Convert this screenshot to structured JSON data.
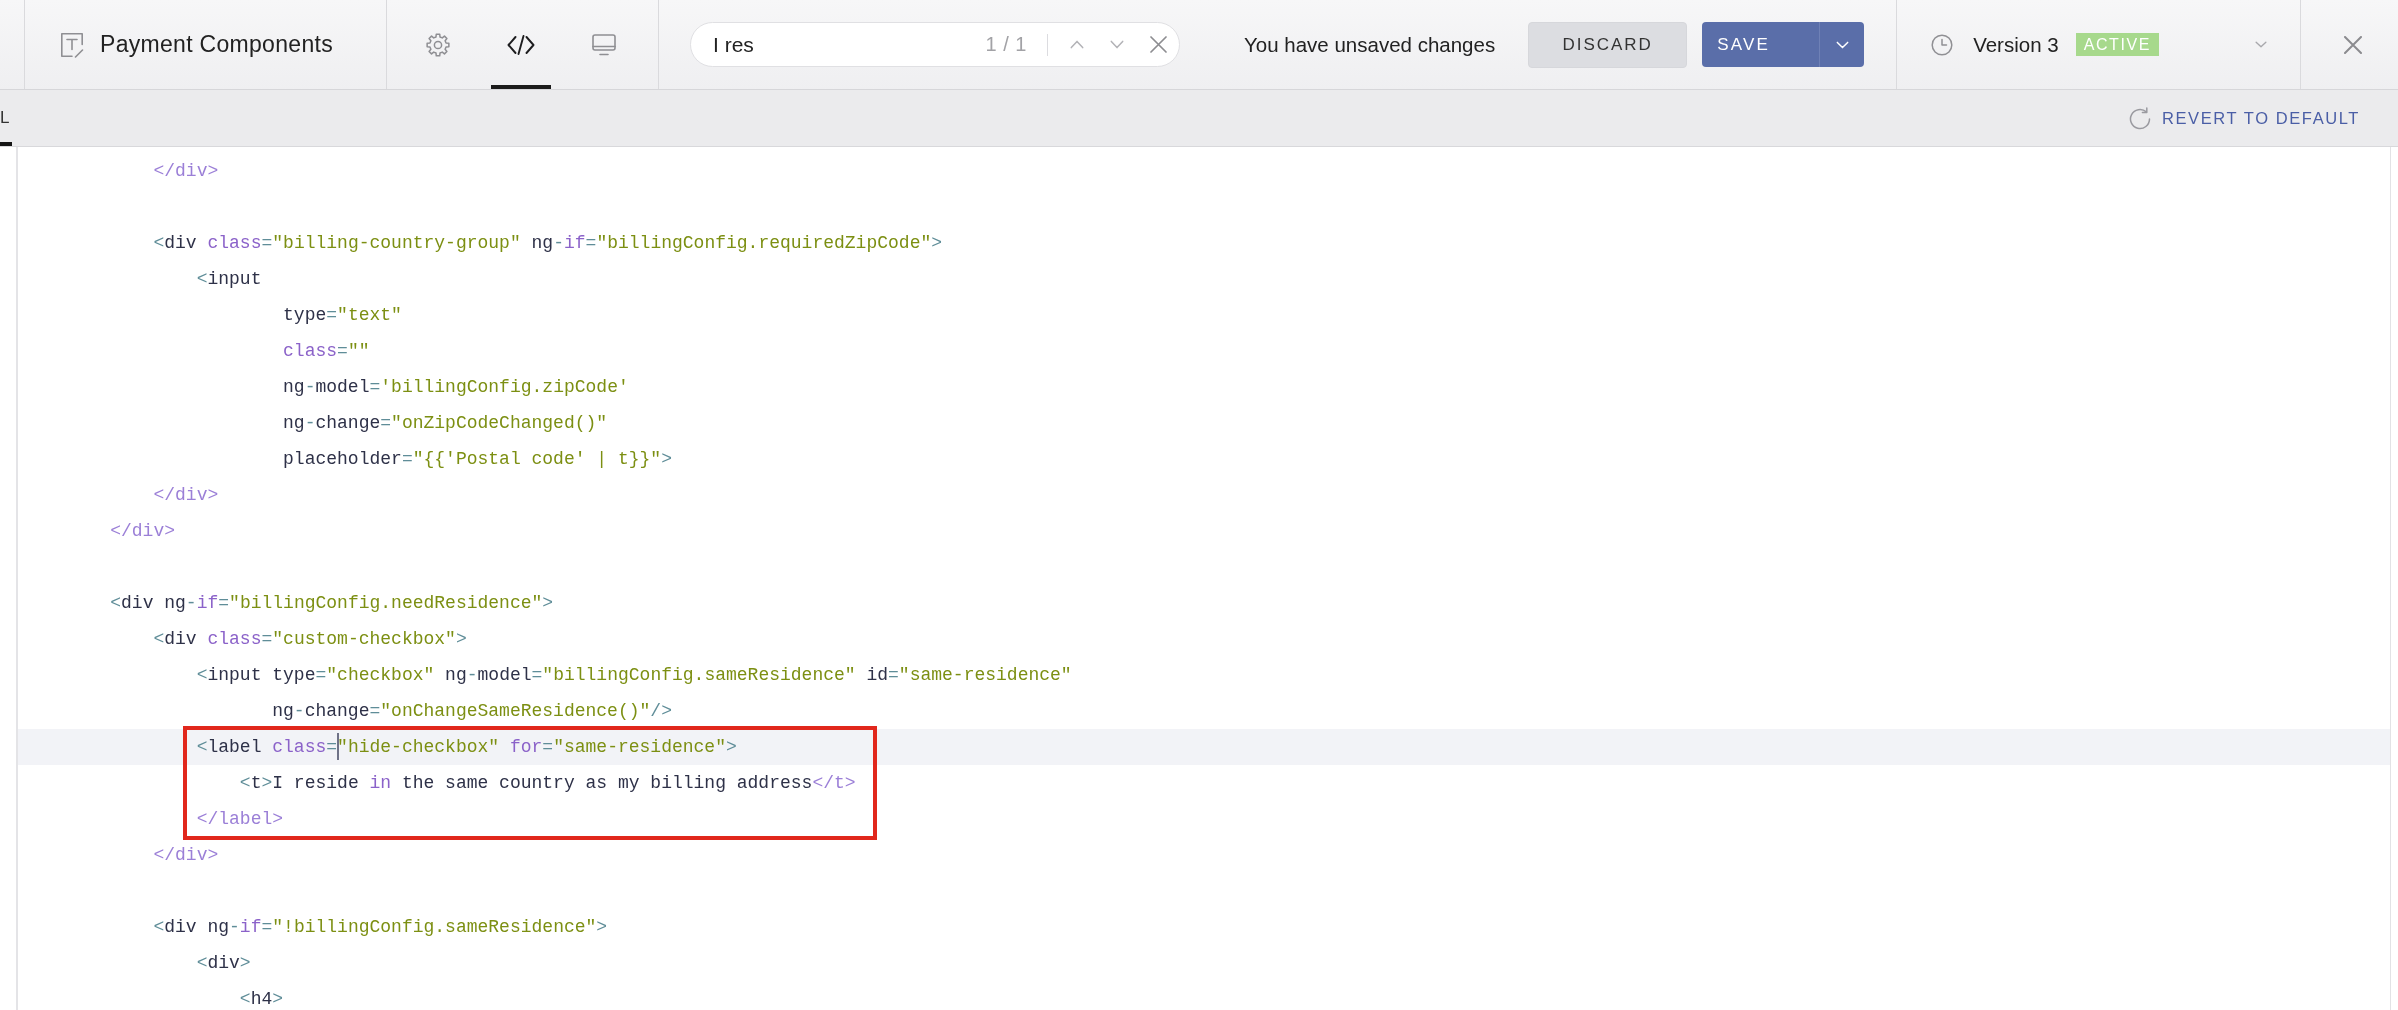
{
  "header": {
    "title": "Payment Components",
    "view_modes": [
      {
        "kind": "settings",
        "selected": false
      },
      {
        "kind": "code",
        "selected": true
      },
      {
        "kind": "preview",
        "selected": false
      }
    ],
    "search": {
      "value": "I res",
      "match_count": "1 / 1"
    },
    "unsaved_message": "You have unsaved changes",
    "discard_button": {
      "label": "DISCARD"
    },
    "save_button": {
      "label": "SAVE"
    },
    "version": {
      "label": "Version 3",
      "status": "ACTIVE"
    }
  },
  "tabs": [
    {
      "label": "L",
      "selected": true
    }
  ],
  "revert_link": {
    "label": "REVERT TO DEFAULT"
  },
  "editor": {
    "lines": [
      {
        "kind": "code",
        "tokens": [
          {
            "kind": "closing",
            "text": "        </div>"
          }
        ],
        "current": false,
        "outlined": false
      },
      {
        "kind": "blank"
      },
      {
        "kind": "code",
        "tokens": [
          {
            "kind": "punct",
            "text": "        <"
          },
          {
            "kind": "plain",
            "text": "div "
          },
          {
            "kind": "keyword",
            "text": "class"
          },
          {
            "kind": "punct",
            "text": "="
          },
          {
            "kind": "string",
            "text": "\"billing-country-group\""
          },
          {
            "kind": "plain",
            "text": " ng"
          },
          {
            "kind": "punct",
            "text": "-"
          },
          {
            "kind": "keyword",
            "text": "if"
          },
          {
            "kind": "punct",
            "text": "="
          },
          {
            "kind": "string",
            "text": "\"billingConfig.requiredZipCode\""
          },
          {
            "kind": "punct",
            "text": ">"
          }
        ],
        "current": false,
        "outlined": false
      },
      {
        "kind": "code",
        "tokens": [
          {
            "kind": "punct",
            "text": "            <"
          },
          {
            "kind": "plain",
            "text": "input"
          }
        ],
        "current": false,
        "outlined": false
      },
      {
        "kind": "code",
        "tokens": [
          {
            "kind": "plain",
            "text": "                    type"
          },
          {
            "kind": "punct",
            "text": "="
          },
          {
            "kind": "string",
            "text": "\"text\""
          }
        ],
        "current": false,
        "outlined": false
      },
      {
        "kind": "code",
        "tokens": [
          {
            "kind": "keyword",
            "text": "                    class"
          },
          {
            "kind": "punct",
            "text": "="
          },
          {
            "kind": "string",
            "text": "\"\""
          }
        ],
        "current": false,
        "outlined": false
      },
      {
        "kind": "code",
        "tokens": [
          {
            "kind": "plain",
            "text": "                    ng"
          },
          {
            "kind": "punct",
            "text": "-"
          },
          {
            "kind": "plain",
            "text": "model"
          },
          {
            "kind": "punct",
            "text": "="
          },
          {
            "kind": "string",
            "text": "'billingConfig.zipCode'"
          }
        ],
        "current": false,
        "outlined": false
      },
      {
        "kind": "code",
        "tokens": [
          {
            "kind": "plain",
            "text": "                    ng"
          },
          {
            "kind": "punct",
            "text": "-"
          },
          {
            "kind": "plain",
            "text": "change"
          },
          {
            "kind": "punct",
            "text": "="
          },
          {
            "kind": "string",
            "text": "\"onZipCodeChanged()\""
          }
        ],
        "current": false,
        "outlined": false
      },
      {
        "kind": "code",
        "tokens": [
          {
            "kind": "plain",
            "text": "                    placeholder"
          },
          {
            "kind": "punct",
            "text": "="
          },
          {
            "kind": "string",
            "text": "\"{{'Postal code' | t}}\""
          },
          {
            "kind": "punct",
            "text": ">"
          }
        ],
        "current": false,
        "outlined": false
      },
      {
        "kind": "code",
        "tokens": [
          {
            "kind": "closing",
            "text": "        </div>"
          }
        ],
        "current": false,
        "outlined": false
      },
      {
        "kind": "code",
        "tokens": [
          {
            "kind": "closing",
            "text": "    </div>"
          }
        ],
        "current": false,
        "outlined": false
      },
      {
        "kind": "blank"
      },
      {
        "kind": "code",
        "tokens": [
          {
            "kind": "punct",
            "text": "    <"
          },
          {
            "kind": "plain",
            "text": "div ng"
          },
          {
            "kind": "punct",
            "text": "-"
          },
          {
            "kind": "keyword",
            "text": "if"
          },
          {
            "kind": "punct",
            "text": "="
          },
          {
            "kind": "string",
            "text": "\"billingConfig.needResidence\""
          },
          {
            "kind": "punct",
            "text": ">"
          }
        ],
        "current": false,
        "outlined": false
      },
      {
        "kind": "code",
        "tokens": [
          {
            "kind": "punct",
            "text": "        <"
          },
          {
            "kind": "plain",
            "text": "div "
          },
          {
            "kind": "keyword",
            "text": "class"
          },
          {
            "kind": "punct",
            "text": "="
          },
          {
            "kind": "string",
            "text": "\"custom-checkbox\""
          },
          {
            "kind": "punct",
            "text": ">"
          }
        ],
        "current": false,
        "outlined": false
      },
      {
        "kind": "code",
        "tokens": [
          {
            "kind": "punct",
            "text": "            <"
          },
          {
            "kind": "plain",
            "text": "input type"
          },
          {
            "kind": "punct",
            "text": "="
          },
          {
            "kind": "string",
            "text": "\"checkbox\""
          },
          {
            "kind": "plain",
            "text": " ng"
          },
          {
            "kind": "punct",
            "text": "-"
          },
          {
            "kind": "plain",
            "text": "model"
          },
          {
            "kind": "punct",
            "text": "="
          },
          {
            "kind": "string",
            "text": "\"billingConfig.sameResidence\""
          },
          {
            "kind": "plain",
            "text": " id"
          },
          {
            "kind": "punct",
            "text": "="
          },
          {
            "kind": "string",
            "text": "\"same-residence\""
          }
        ],
        "current": false,
        "outlined": false
      },
      {
        "kind": "code",
        "tokens": [
          {
            "kind": "plain",
            "text": "                   ng"
          },
          {
            "kind": "punct",
            "text": "-"
          },
          {
            "kind": "plain",
            "text": "change"
          },
          {
            "kind": "punct",
            "text": "="
          },
          {
            "kind": "string",
            "text": "\"onChangeSameResidence()\""
          },
          {
            "kind": "punct",
            "text": "/>"
          }
        ],
        "current": false,
        "outlined": false
      },
      {
        "kind": "code",
        "tokens": [
          {
            "kind": "punct",
            "text": "            <"
          },
          {
            "kind": "plain",
            "text": "label "
          },
          {
            "kind": "keyword",
            "text": "class"
          },
          {
            "kind": "punct",
            "text": "="
          },
          {
            "kind": "cursor"
          },
          {
            "kind": "string",
            "text": "\"hide-checkbox\" "
          },
          {
            "kind": "keyword",
            "text": "for"
          },
          {
            "kind": "punct",
            "text": "="
          },
          {
            "kind": "string",
            "text": "\"same-residence\""
          },
          {
            "kind": "punct",
            "text": ">"
          }
        ],
        "current": true,
        "outlined": true
      },
      {
        "kind": "code",
        "tokens": [
          {
            "kind": "punct",
            "text": "                <"
          },
          {
            "kind": "plain",
            "text": "t"
          },
          {
            "kind": "punct",
            "text": ">"
          },
          {
            "kind": "plain",
            "text": "I reside "
          },
          {
            "kind": "keyword",
            "text": "in"
          },
          {
            "kind": "plain",
            "text": " the same country as my billing address"
          },
          {
            "kind": "closing",
            "text": "</t>"
          }
        ],
        "current": false,
        "outlined": true
      },
      {
        "kind": "code",
        "tokens": [
          {
            "kind": "closing",
            "text": "            </label>"
          }
        ],
        "current": false,
        "outlined": true
      },
      {
        "kind": "code",
        "tokens": [
          {
            "kind": "closing",
            "text": "        </div>"
          }
        ],
        "current": false,
        "outlined": false
      },
      {
        "kind": "blank"
      },
      {
        "kind": "code",
        "tokens": [
          {
            "kind": "punct",
            "text": "        <"
          },
          {
            "kind": "plain",
            "text": "div ng"
          },
          {
            "kind": "punct",
            "text": "-"
          },
          {
            "kind": "keyword",
            "text": "if"
          },
          {
            "kind": "punct",
            "text": "="
          },
          {
            "kind": "string",
            "text": "\"!billingConfig.sameResidence\""
          },
          {
            "kind": "punct",
            "text": ">"
          }
        ],
        "current": false,
        "outlined": false
      },
      {
        "kind": "code",
        "tokens": [
          {
            "kind": "punct",
            "text": "            <"
          },
          {
            "kind": "plain",
            "text": "div"
          },
          {
            "kind": "punct",
            "text": ">"
          }
        ],
        "current": false,
        "outlined": false
      },
      {
        "kind": "code",
        "tokens": [
          {
            "kind": "punct",
            "text": "                <"
          },
          {
            "kind": "plain",
            "text": "h4"
          },
          {
            "kind": "punct",
            "text": ">"
          }
        ],
        "current": false,
        "outlined": false
      }
    ]
  }
}
